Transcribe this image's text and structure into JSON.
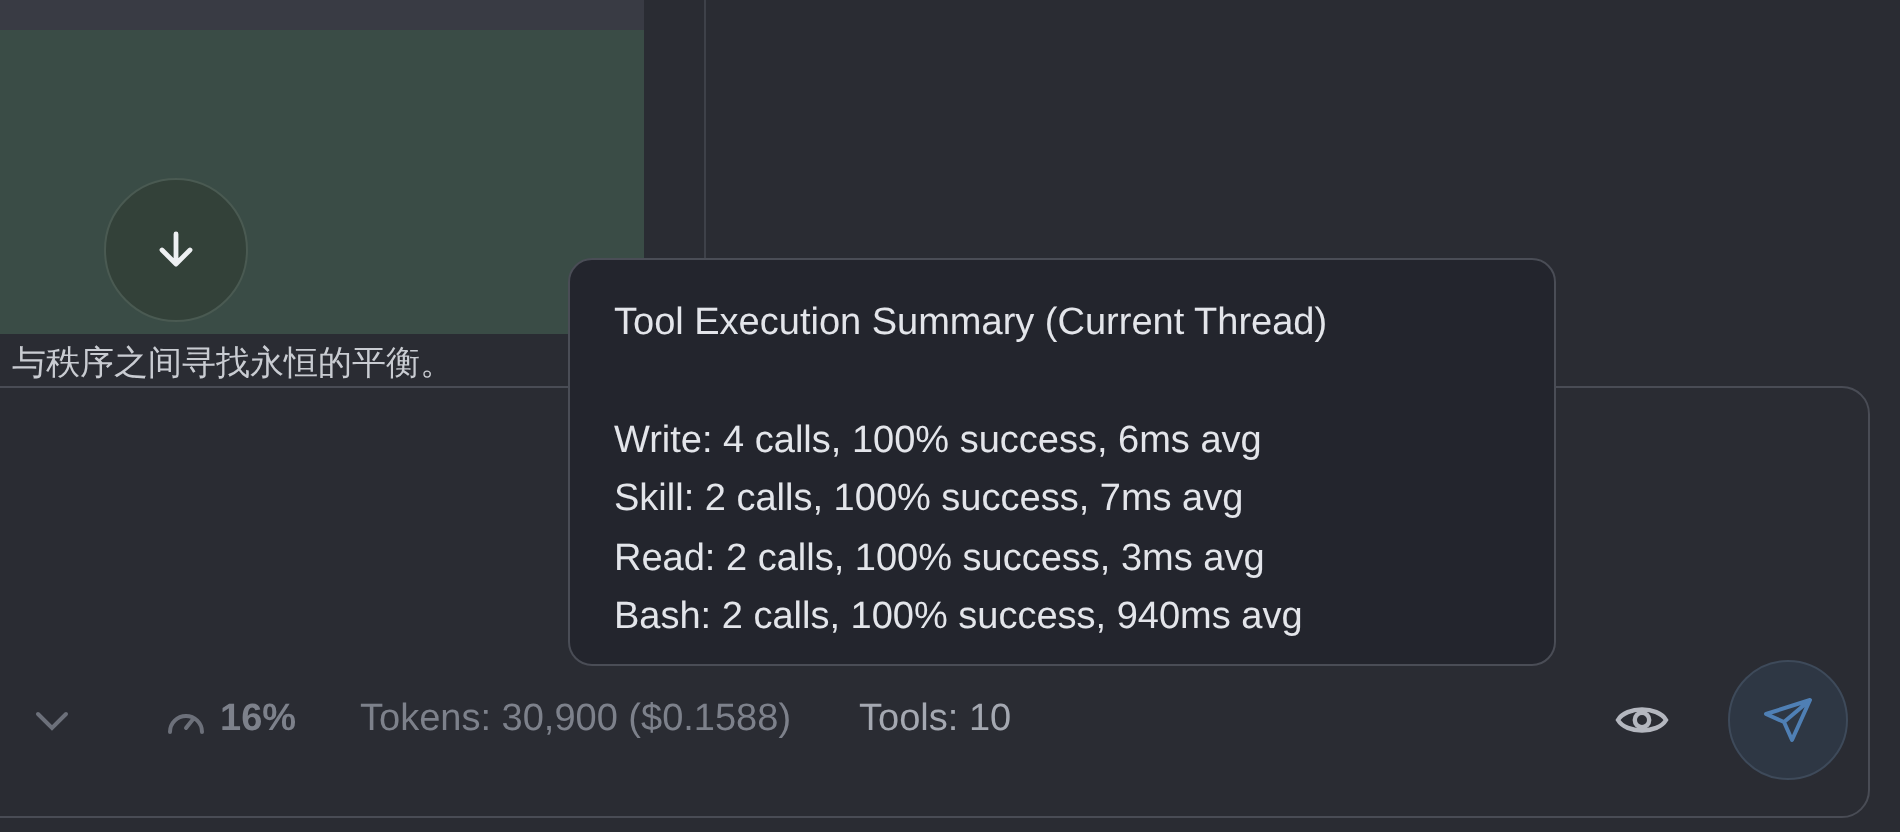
{
  "chat": {
    "message_tail": "与秩序之间寻找永恒的平衡。"
  },
  "composer": {
    "context_usage": "16%",
    "tokens": "Tokens: 30,900 ($0.1588)",
    "tools": "Tools: 10"
  },
  "tooltip": {
    "title": "Tool Execution Summary (Current Thread)",
    "lines": [
      "Write: 4 calls, 100% success, 6ms avg",
      "Skill: 2 calls, 100% success, 7ms avg",
      "Read: 2 calls, 100% success, 3ms avg",
      "Bash: 2 calls, 100% success, 940ms avg"
    ]
  }
}
